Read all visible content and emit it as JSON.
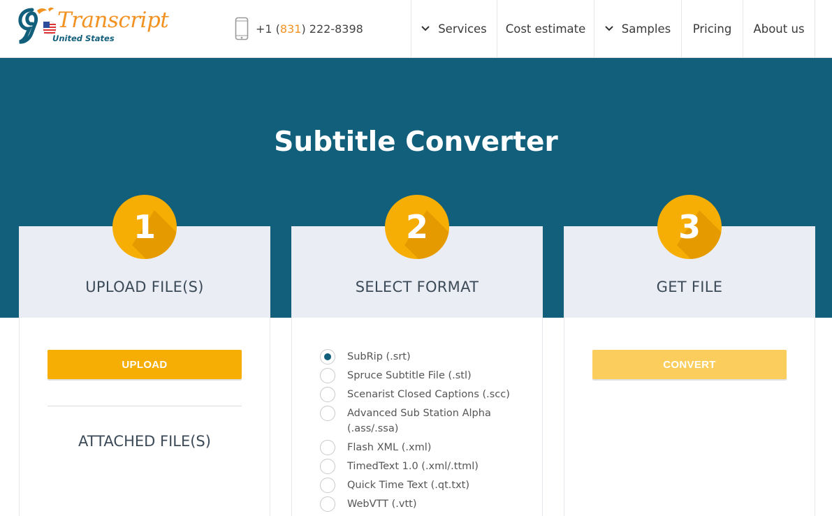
{
  "brand": {
    "name": "Transcript",
    "subtitle": "United States",
    "colors": {
      "orange": "#f29222",
      "teal": "#125f7c",
      "yellow": "#f7ae04"
    }
  },
  "contact": {
    "phone_prefix": "+1 (",
    "phone_area": "831",
    "phone_suffix": ") 222-8398"
  },
  "nav": {
    "services": "Services",
    "cost_estimate": "Cost estimate",
    "samples": "Samples",
    "pricing": "Pricing",
    "about": "About us"
  },
  "hero": {
    "title": "Subtitle Converter"
  },
  "steps": [
    {
      "number": "1",
      "title": "UPLOAD FILE(S)"
    },
    {
      "number": "2",
      "title": "SELECT FORMAT"
    },
    {
      "number": "3",
      "title": "GET FILE"
    }
  ],
  "upload": {
    "button": "UPLOAD",
    "attached_title": "ATTACHED FILE(S)"
  },
  "formats": {
    "selected": "SubRip (.srt)",
    "options": [
      "SubRip (.srt)",
      "Spruce Subtitle File (.stl)",
      "Scenarist Closed Captions (.scc)",
      "Advanced Sub Station Alpha (.ass/.ssa)",
      "Flash XML (.xml)",
      "TimedText 1.0 (.xml/.ttml)",
      "Quick Time Text (.qt.txt)",
      "WebVTT (.vtt)"
    ]
  },
  "convert": {
    "button": "CONVERT"
  }
}
